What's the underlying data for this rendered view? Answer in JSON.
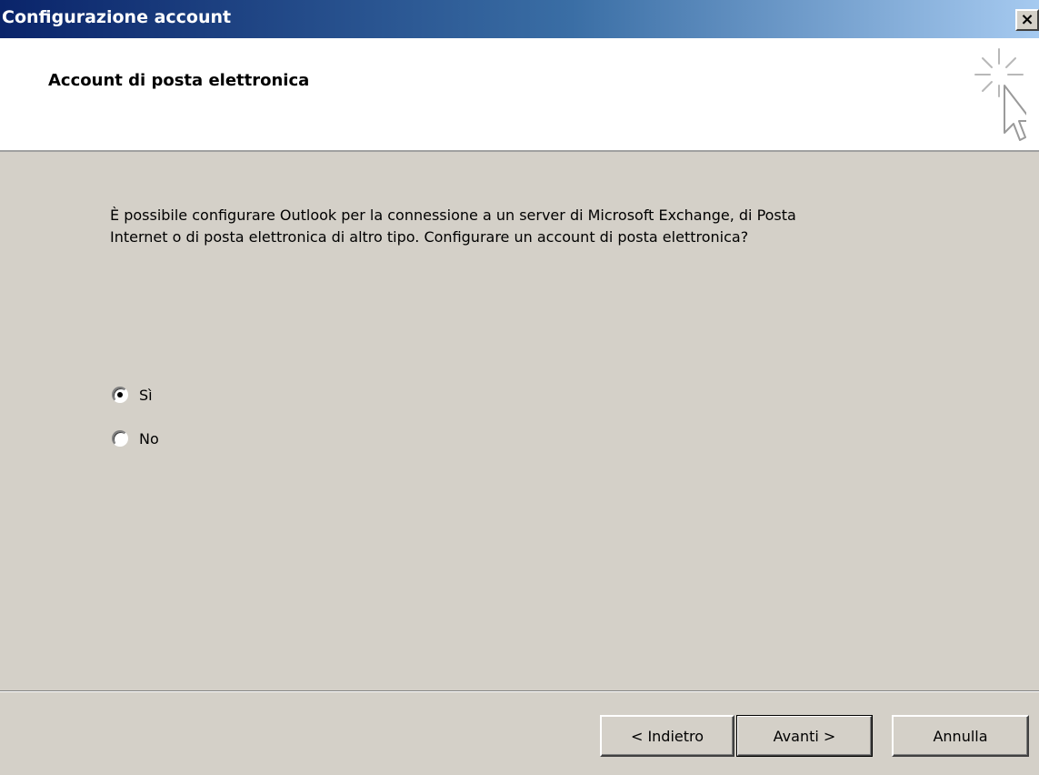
{
  "window": {
    "title": "Configurazione account",
    "close_label": "×"
  },
  "header": {
    "title": "Account di posta elettronica",
    "icon": "wizard-sparkle-cursor-icon"
  },
  "main": {
    "description": "È possibile configurare Outlook per la connessione a un server di Microsoft Exchange, di Posta Internet o di posta elettronica di altro tipo. Configurare un account di posta elettronica?",
    "options": [
      {
        "label": "Sì",
        "checked": true
      },
      {
        "label": "No",
        "checked": false
      }
    ]
  },
  "footer": {
    "back_label": "< Indietro",
    "next_label": "Avanti >",
    "cancel_label": "Annulla"
  }
}
